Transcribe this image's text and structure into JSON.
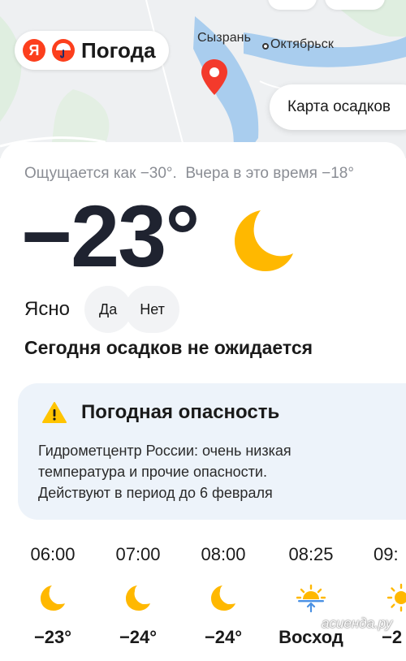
{
  "map": {
    "labels": {
      "city_main": "Сызрань",
      "city_second": "Октябрьск"
    },
    "brand": {
      "logo_letter": "Я",
      "name": "Погода"
    },
    "precip_map_button": "Карта осадков"
  },
  "current": {
    "feels_like": "Ощущается как −30°.",
    "yesterday": "Вчера в это время −18°",
    "temperature": "−23°",
    "condition": "Ясно",
    "condition_icon": "moon-icon",
    "vote_yes": "Да",
    "vote_no": "Нет",
    "precipitation": "Сегодня осадков не ожидается"
  },
  "alert": {
    "icon": "warning-icon",
    "title": "Погодная опасность",
    "lines": [
      "Гидрометцентр России: очень низкая",
      "температура и прочие опасности.",
      "Действуют в период до 6 февраля"
    ]
  },
  "hourly": [
    {
      "time": "06:00",
      "icon": "moon-icon",
      "value": "−23°"
    },
    {
      "time": "07:00",
      "icon": "moon-icon",
      "value": "−24°"
    },
    {
      "time": "08:00",
      "icon": "moon-icon",
      "value": "−24°"
    },
    {
      "time": "08:25",
      "icon": "sunrise-icon",
      "value": "Восход"
    },
    {
      "time": "09:",
      "icon": "sun-icon",
      "value": "−2"
    }
  ],
  "watermark": "асиенда.ру",
  "colors": {
    "accent_red": "#fc3f1d",
    "moon": "#ffb800",
    "alert_bg": "#edf3fa",
    "pin": "#f33a2c"
  }
}
